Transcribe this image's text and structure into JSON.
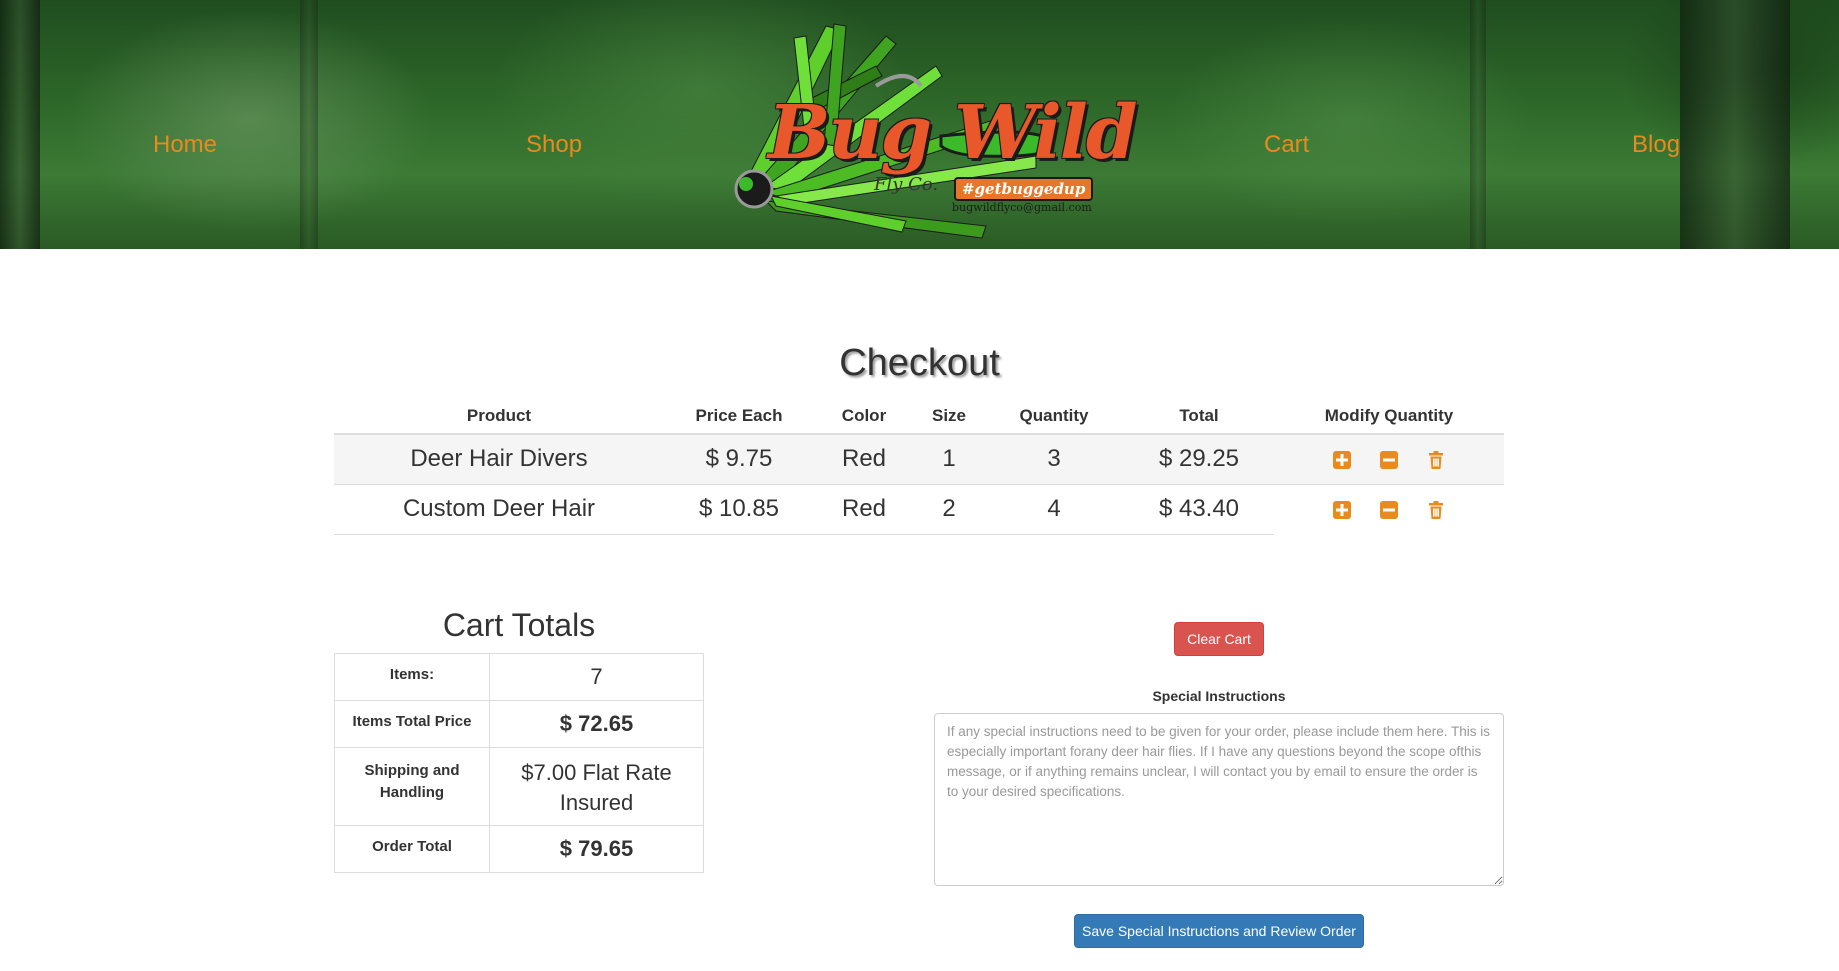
{
  "nav": {
    "home": "Home",
    "shop": "Shop",
    "cart": "Cart",
    "blog": "Blog"
  },
  "logo": {
    "name": "Bug Wild",
    "subtitle": "Fly Co.",
    "hashtag": "#getbuggedup",
    "email": "bugwildflyco@gmail.com"
  },
  "checkout": {
    "title": "Checkout",
    "columns": [
      "Product",
      "Price Each",
      "Color",
      "Size",
      "Quantity",
      "Total",
      "Modify Quantity"
    ],
    "rows": [
      {
        "product": "Deer Hair Divers",
        "price": "$ 9.75",
        "color": "Red",
        "size": "1",
        "quantity": "3",
        "total": "$ 29.25"
      },
      {
        "product": "Custom Deer Hair",
        "price": "$ 10.85",
        "color": "Red",
        "size": "2",
        "quantity": "4",
        "total": "$ 43.40"
      }
    ]
  },
  "totals": {
    "title": "Cart Totals",
    "items_label": "Items:",
    "items_value": "7",
    "items_total_label": "Items Total Price",
    "items_total_value": "$ 72.65",
    "shipping_label": "Shipping and Handling",
    "shipping_value": "$7.00 Flat Rate Insured",
    "order_total_label": "Order Total",
    "order_total_value": "$ 79.65"
  },
  "actions": {
    "clear_cart": "Clear Cart",
    "special_instructions_label": "Special Instructions",
    "special_instructions_placeholder": "If any special instructions need to be given for your order, please include them here. This is especially important forany deer hair flies. If I have any questions beyond the scope ofthis message, or if anything remains unclear, I will contact you by email to ensure the order is to your desired specifications.",
    "save_review": "Save Special Instructions and Review Order"
  },
  "colors": {
    "accent": "#e88a1e",
    "danger": "#d9534f",
    "primary": "#337ab7"
  },
  "icons": {
    "increase": "plus-square-icon",
    "decrease": "minus-square-icon",
    "remove": "trash-icon"
  }
}
